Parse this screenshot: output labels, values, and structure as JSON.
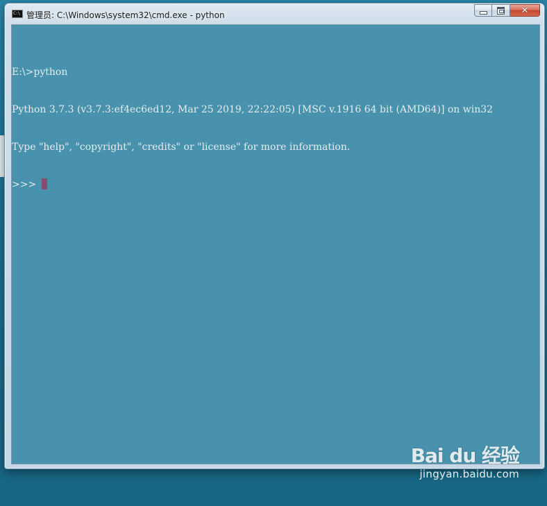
{
  "window": {
    "title": "管理员: C:\\Windows\\system32\\cmd.exe - python",
    "icon": "cmd-icon",
    "icon_text": "C:\\",
    "buttons": {
      "minimize": "minimize-icon",
      "maximize": "maximize-icon",
      "close": "close-icon",
      "close_glyph": "✕"
    }
  },
  "console": {
    "background": "#4892ae",
    "text_color": "#e6ecef",
    "cursor_color": "#8a4c6c",
    "lines": [
      "E:\\>python",
      "Python 3.7.3 (v3.7.3:ef4ec6ed12, Mar 25 2019, 22:22:05) [MSC v.1916 64 bit (AMD64)] on win32",
      "Type \"help\", \"copyright\", \"credits\" or \"license\" for more information."
    ],
    "prompt": ">>>"
  },
  "watermark": {
    "logo": "Bai du 经验",
    "url": "jingyan.baidu.com"
  }
}
